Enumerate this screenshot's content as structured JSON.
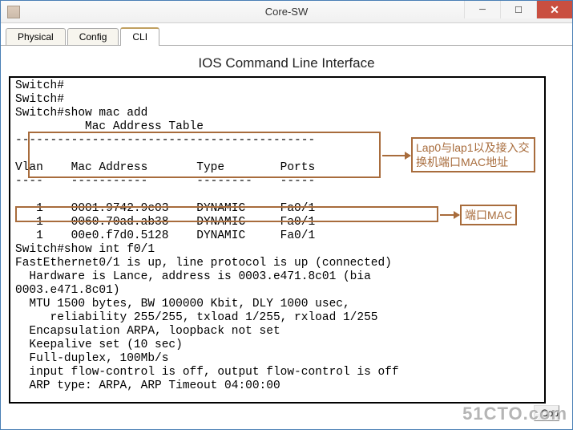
{
  "window": {
    "title": "Core-SW"
  },
  "tabs": [
    {
      "label": "Physical"
    },
    {
      "label": "Config"
    },
    {
      "label": "CLI"
    }
  ],
  "cli": {
    "title": "IOS Command Line Interface",
    "lines": [
      "Switch#",
      "Switch#",
      "Switch#show mac add",
      "          Mac Address Table",
      "-------------------------------------------",
      "",
      "Vlan    Mac Address       Type        Ports",
      "----    -----------       --------    -----",
      "",
      "   1    0001.9742.9c03    DYNAMIC     Fa0/1",
      "   1    0060.70ad.ab38    DYNAMIC     Fa0/1",
      "   1    00e0.f7d0.5128    DYNAMIC     Fa0/1",
      "Switch#show int f0/1",
      "FastEthernet0/1 is up, line protocol is up (connected)",
      "  Hardware is Lance, address is 0003.e471.8c01 (bia",
      "0003.e471.8c01)",
      "  MTU 1500 bytes, BW 100000 Kbit, DLY 1000 usec,",
      "     reliability 255/255, txload 1/255, rxload 1/255",
      "  Encapsulation ARPA, loopback not set",
      "  Keepalive set (10 sec)",
      "  Full-duplex, 100Mb/s",
      "  input flow-control is off, output flow-control is off",
      "  ARP type: ARPA, ARP Timeout 04:00:00"
    ],
    "mac_table": [
      {
        "vlan": 1,
        "mac": "0001.9742.9c03",
        "type": "DYNAMIC",
        "port": "Fa0/1"
      },
      {
        "vlan": 1,
        "mac": "0060.70ad.ab38",
        "type": "DYNAMIC",
        "port": "Fa0/1"
      },
      {
        "vlan": 1,
        "mac": "00e0.f7d0.5128",
        "type": "DYNAMIC",
        "port": "Fa0/1"
      }
    ],
    "interface_mac": "0003.e471.8c01"
  },
  "annotations": {
    "label1": "Lap0与lap1以及接入交换机端口MAC地址",
    "label2": "端口MAC"
  },
  "buttons": {
    "copy": "Cop"
  },
  "watermark": "51CTO.com"
}
